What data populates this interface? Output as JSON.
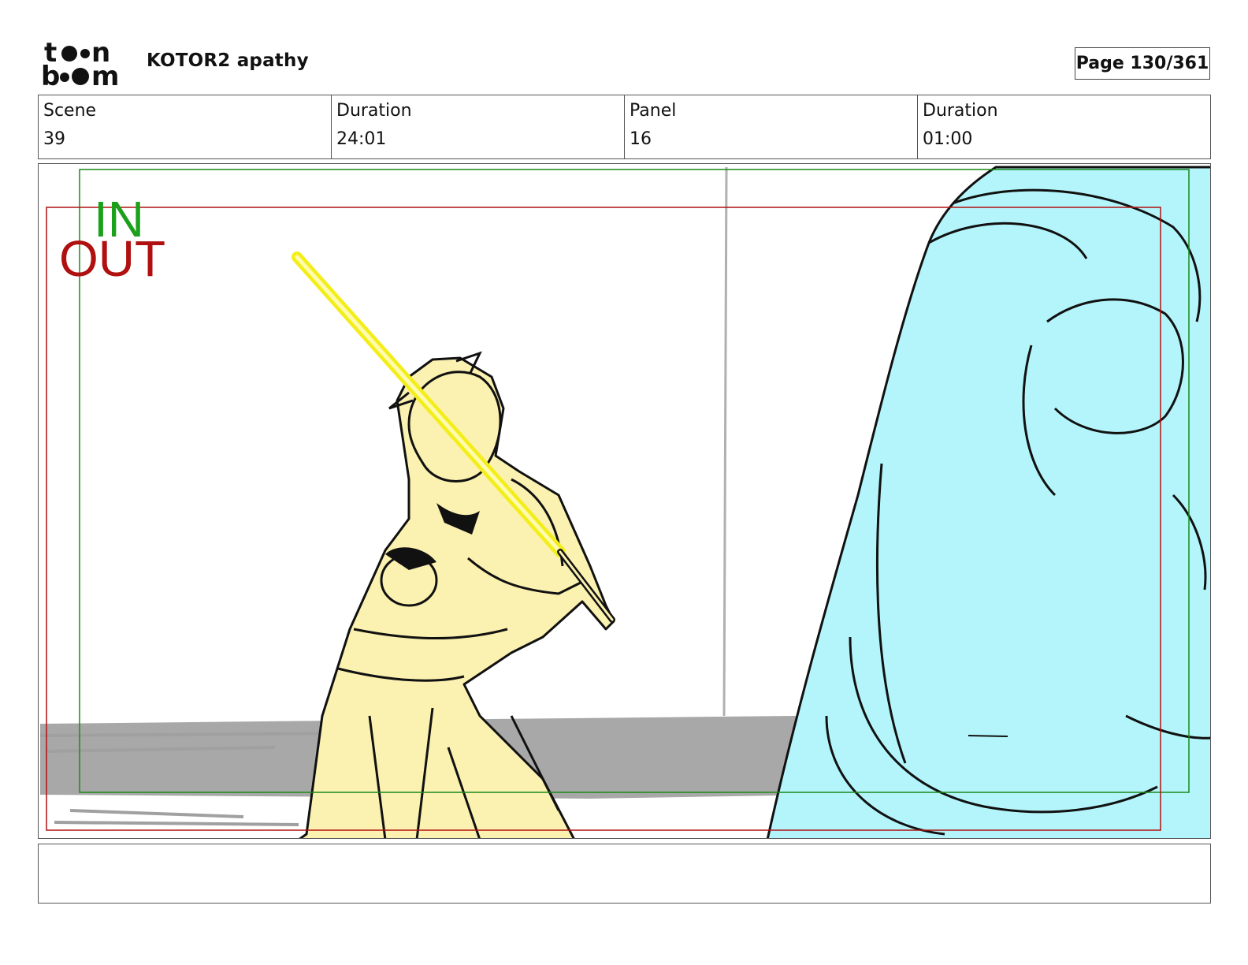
{
  "header": {
    "logo": {
      "line1": "toon",
      "line2": "boom",
      "name": "toon-boom-logo"
    },
    "project_title": "KOTOR2 apathy",
    "page_label": "Page 130/361"
  },
  "info": [
    {
      "label": "Scene",
      "value": "39"
    },
    {
      "label": "Duration",
      "value": "24:01"
    },
    {
      "label": "Panel",
      "value": "16"
    },
    {
      "label": "Duration",
      "value": "01:00"
    }
  ],
  "panel": {
    "in_label": "IN",
    "out_label": "OUT",
    "colors": {
      "in_frame": "#1a8a1a",
      "out_frame": "#b01010",
      "lightsaber": "#f3ee1a",
      "character_fill": "#fbf1b0",
      "foreground_fill": "#b4f5fb",
      "floor": "#a8a8a8"
    }
  },
  "notes": {
    "text": ""
  }
}
